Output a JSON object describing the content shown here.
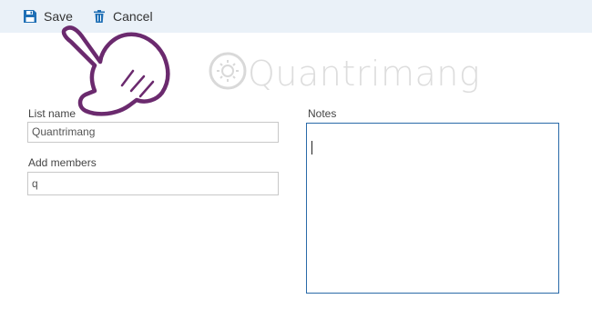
{
  "toolbar": {
    "save_label": "Save",
    "cancel_label": "Cancel"
  },
  "form": {
    "list_name_label": "List name",
    "list_name_value": "Quantrimang",
    "add_members_label": "Add members",
    "add_members_value": "q",
    "notes_label": "Notes",
    "notes_value": ""
  },
  "watermark": {
    "text": "Quantrimang"
  },
  "colors": {
    "toolbar_bg": "#eaf1f8",
    "accent": "#1f6fb5",
    "notes_border": "#2a6aa8",
    "hand_outline": "#6b2a6e"
  },
  "icons": {
    "save": "floppy-disk-icon",
    "cancel": "trash-icon",
    "watermark": "sun-logo-icon",
    "pointer": "pointing-hand-icon"
  }
}
